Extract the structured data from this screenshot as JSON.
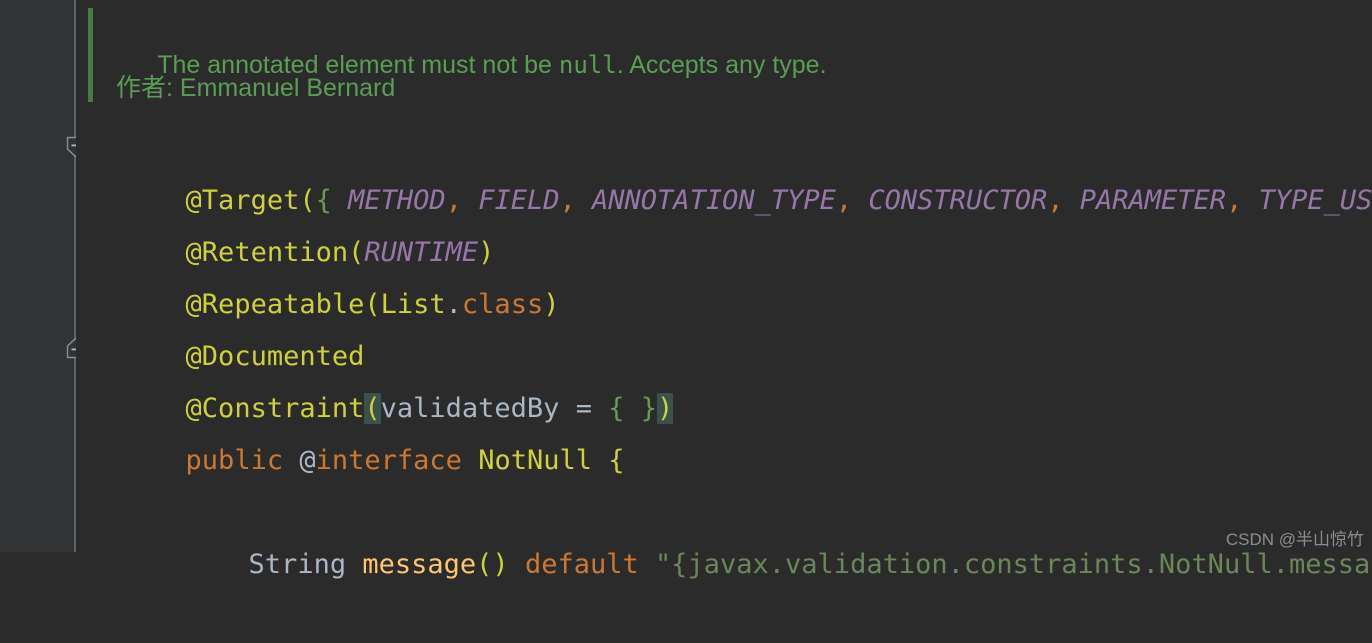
{
  "app": {
    "kind": "code-editor",
    "theme": "darcula",
    "background": "#2b2b2b",
    "gutter_background": "#313335"
  },
  "javadoc": {
    "line1_prefix": "The annotated element must not be ",
    "line1_code": "null",
    "line1_suffix": ". Accepts any type.",
    "line2": "作者: Emmanuel Bernard",
    "color": "#5a9e55",
    "bar_color": "#4a7a43"
  },
  "code_lines": [
    {
      "id": "target",
      "text": "@Target({ METHOD, FIELD, ANNOTATION_TYPE, CONSTRUCTOR, PARAMETER, TYPE_USE })",
      "fold_marker": "collapse-down"
    },
    {
      "id": "retention",
      "text": "@Retention(RUNTIME)",
      "fold_marker": null
    },
    {
      "id": "repeatable",
      "text": "@Repeatable(List.class)",
      "fold_marker": null
    },
    {
      "id": "documented",
      "text": "@Documented",
      "fold_marker": null
    },
    {
      "id": "constraint",
      "text": "@Constraint(validatedBy = { })",
      "fold_marker": "collapse-up"
    },
    {
      "id": "declaration",
      "text": "public @interface NotNull {",
      "fold_marker": null
    },
    {
      "id": "message",
      "text": "    String message() default \"{javax.validation.constraints.NotNull.message}\";",
      "fold_marker": null
    }
  ],
  "tokens": {
    "at_target": "@Target",
    "paren_open": "(",
    "brace_open": "{",
    "method_const": "METHOD",
    "field_const": "FIELD",
    "annotation_type_const": "ANNOTATION_TYPE",
    "constructor_const": "CONSTRUCTOR",
    "parameter_const": "PARAMETER",
    "type_use_const": "TYPE_USE",
    "brace_close": "}",
    "paren_close": ")",
    "comma": ",",
    "at_retention": "@Retention",
    "runtime_const": "RUNTIME",
    "at_repeatable": "@Repeatable",
    "list_ident": "List",
    "dot": ".",
    "class_kw": "class",
    "at_documented": "@Documented",
    "at_constraint": "@Constraint",
    "validated_by": "validatedBy",
    "equals": " = ",
    "empty_braces": "{ }",
    "public_kw": "public",
    "at_sign": "@",
    "interface_kw": "interface",
    "notnull_cls": "NotNull",
    "brace_body_open": "{",
    "string_type": "String",
    "message_method": "message",
    "empty_parens": "()",
    "default_kw": "default",
    "message_string": "\"{javax.validation.constraints.NotNull.message}\"",
    "semicolon": ";"
  },
  "colors": {
    "annotation": "#d0d03a",
    "constant": "#9876aa",
    "comma": "#cc7832",
    "brace_green": "#6a9955",
    "keyword": "#cc7832",
    "identifier": "#a9b7c6",
    "method": "#ffc66d",
    "string": "#6a8759",
    "bracket_highlight": "#3b514d"
  },
  "watermark": {
    "text": "CSDN @半山惊竹"
  }
}
